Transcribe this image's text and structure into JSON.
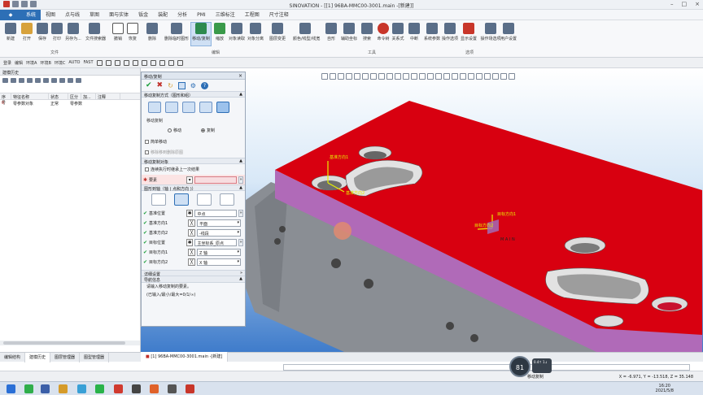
{
  "titlebar": {
    "title": "SINOVATION - [[1] 96BA-MMC00-3001.main -[新建]]"
  },
  "menu": {
    "items": [
      "系统",
      "视图",
      "点与线",
      "草图",
      "面与实体",
      "钣金",
      "装配",
      "分析",
      "PMI",
      "三维标注",
      "工程图",
      "尺寸注释"
    ],
    "active": "系统"
  },
  "ribbon": {
    "file": [
      {
        "label": "新建"
      },
      {
        "label": "打开"
      },
      {
        "label": "保存"
      },
      {
        "label": "打印"
      },
      {
        "label": "另存为..."
      },
      {
        "label": "文件搜索器"
      }
    ],
    "edit": [
      {
        "label": "撤销"
      },
      {
        "label": "恢复"
      },
      {
        "label": "删除"
      },
      {
        "label": "删除临时图形"
      },
      {
        "label": "移动/复制"
      },
      {
        "label": "缩放"
      },
      {
        "label": "对象读取"
      },
      {
        "label": "对象分离"
      },
      {
        "label": "图层变更"
      },
      {
        "label": "颜色/线型/线宽"
      }
    ],
    "tools": [
      {
        "label": "自形"
      },
      {
        "label": "辅助坐标"
      },
      {
        "label": "搜索"
      },
      {
        "label": "命令树"
      },
      {
        "label": "关系式"
      },
      {
        "label": "中断"
      }
    ],
    "options": [
      {
        "label": "系统参数"
      },
      {
        "label": "操作选项"
      },
      {
        "label": "显示设置"
      },
      {
        "label": "操作场选项"
      },
      {
        "label": "用户设置"
      }
    ],
    "groups": {
      "file": "文件",
      "edit": "编辑",
      "tools": "工具",
      "options": "选项"
    }
  },
  "toolbar2": {
    "items": [
      "登录",
      "编辑",
      "环境A",
      "环境B",
      "环境C",
      "AUTO",
      "FAST"
    ]
  },
  "history": {
    "title": "建模历史",
    "columns": [
      "序号",
      "特征名称",
      "状态",
      "区分",
      "加...",
      "注释"
    ],
    "rows": [
      {
        "index": "0",
        "name": "零参数对象",
        "status": "正常",
        "kind": "零参数"
      }
    ]
  },
  "dialog": {
    "title": "移动/复制",
    "section_method": "移动复制方式（图形和组）",
    "move_copy_label": "移动复制",
    "radio_move": "移动",
    "radio_copy": "复制",
    "simple_transform": "简单移动",
    "keep_original": "移除移到删除原图",
    "section_object": "移动复制对象",
    "continuous": "连续执行时继承上一次结果",
    "element_label": "要素",
    "section_axis": "图形到轴（轴 ( 点和方向 )）",
    "rows": [
      {
        "label": "基准位置",
        "value": "中点"
      },
      {
        "label": "基准方向1",
        "value": "平面"
      },
      {
        "label": "基准方向2",
        "value": "-线段"
      },
      {
        "label": "目标位置",
        "value": "主坐标系_原点"
      },
      {
        "label": "目标方向1",
        "value": "Z 轴"
      },
      {
        "label": "目标方向2",
        "value": "X 轴"
      }
    ],
    "details": "详细设置",
    "nav": "导航信息",
    "hint1": "请输入移动复制的要素。",
    "hint2": "(已输入/最小/最大=0/1/∞)"
  },
  "viewport": {
    "labels": {
      "base_dir1": "基准方向1",
      "base_dir2": "基准方向2",
      "target_dir1": "目标方向1",
      "target_dir2": "目标方向2",
      "main": "M A I N"
    },
    "colors": {
      "top": "#d80010",
      "side": "#b06ab8",
      "body": "#8a8e94"
    }
  },
  "bottom_tabs": [
    "编辑结构",
    "建模历史",
    "图层管理器",
    "图型管理器"
  ],
  "doc_tab": "[1] 96BA-MMC00-3001.main -[新建]",
  "status": {
    "text": "移动复制",
    "coords": "X = -6.971, Y = -13.518, Z = 35.148",
    "gauge": "81",
    "gauge_sub": "0.4↑\n1↓"
  },
  "taskbar": {
    "time": "16:20",
    "date": "2021/5/8"
  }
}
